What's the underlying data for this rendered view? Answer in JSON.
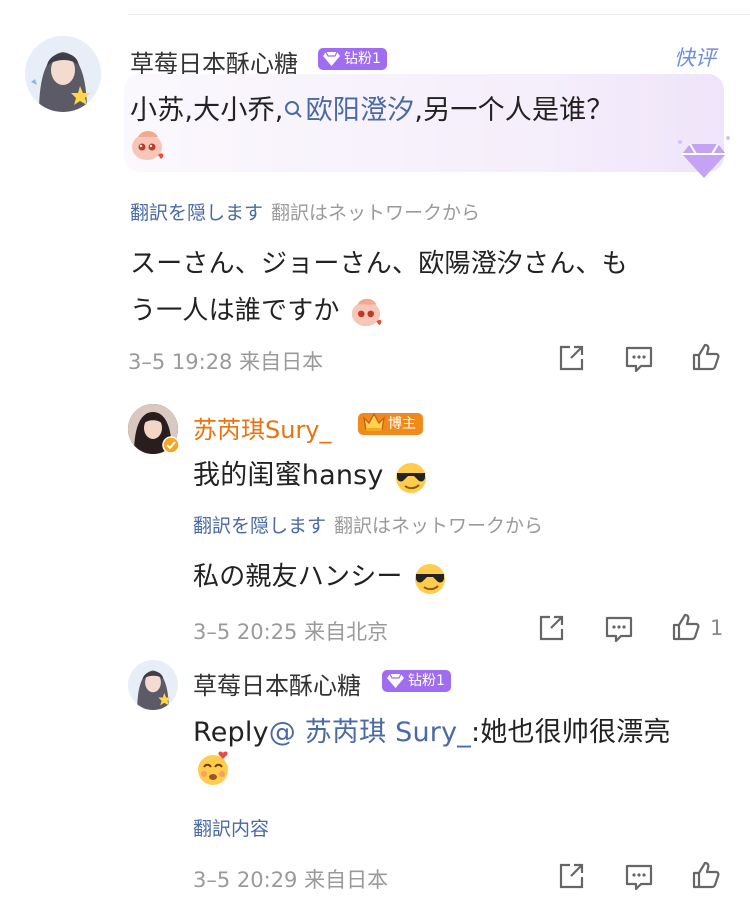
{
  "comment1": {
    "username": "草莓日本酥心糖",
    "badge": "钻粉1",
    "quick_review": "快评",
    "text_prefix": "小苏,大小乔,",
    "mention": "欧阳澄汐",
    "text_suffix": ",另一个人是谁？",
    "hide_translation": "翻訳を隠します",
    "translation_source": "翻訳はネットワークから",
    "translation_line1": "スーさん、ジョーさん、欧陽澄汐さん、も",
    "translation_line2": "う一人は誰ですか",
    "timestamp": "3–5 19:28 来自日本"
  },
  "reply1": {
    "username": "苏芮琪Sury_",
    "badge": "博主",
    "text": "我的闺蜜hansy",
    "hide_translation": "翻訳を隠します",
    "translation_source": "翻訳はネットワークから",
    "translation": "私の親友ハンシー",
    "timestamp": "3–5 20:25 来自北京",
    "like_count": "1"
  },
  "reply2": {
    "username": "草莓日本酥心糖",
    "badge": "钻粉1",
    "reply_prefix": "Reply",
    "mention": "@ 苏芮琪 Sury_",
    "text": ":她也很帅很漂亮",
    "translate_content": "翻訳内容",
    "timestamp": "3–5 20:29 来自日本"
  },
  "colors": {
    "link": "#4a6aa5",
    "blogger_name": "#e8730f",
    "fan_badge": "#a06cf0",
    "blogger_badge": "#f08a1c",
    "meta": "#9a9a9a"
  },
  "icons": [
    "share-icon",
    "comment-icon",
    "like-icon",
    "search-icon",
    "diamond-icon",
    "crown-icon",
    "verified-icon"
  ]
}
